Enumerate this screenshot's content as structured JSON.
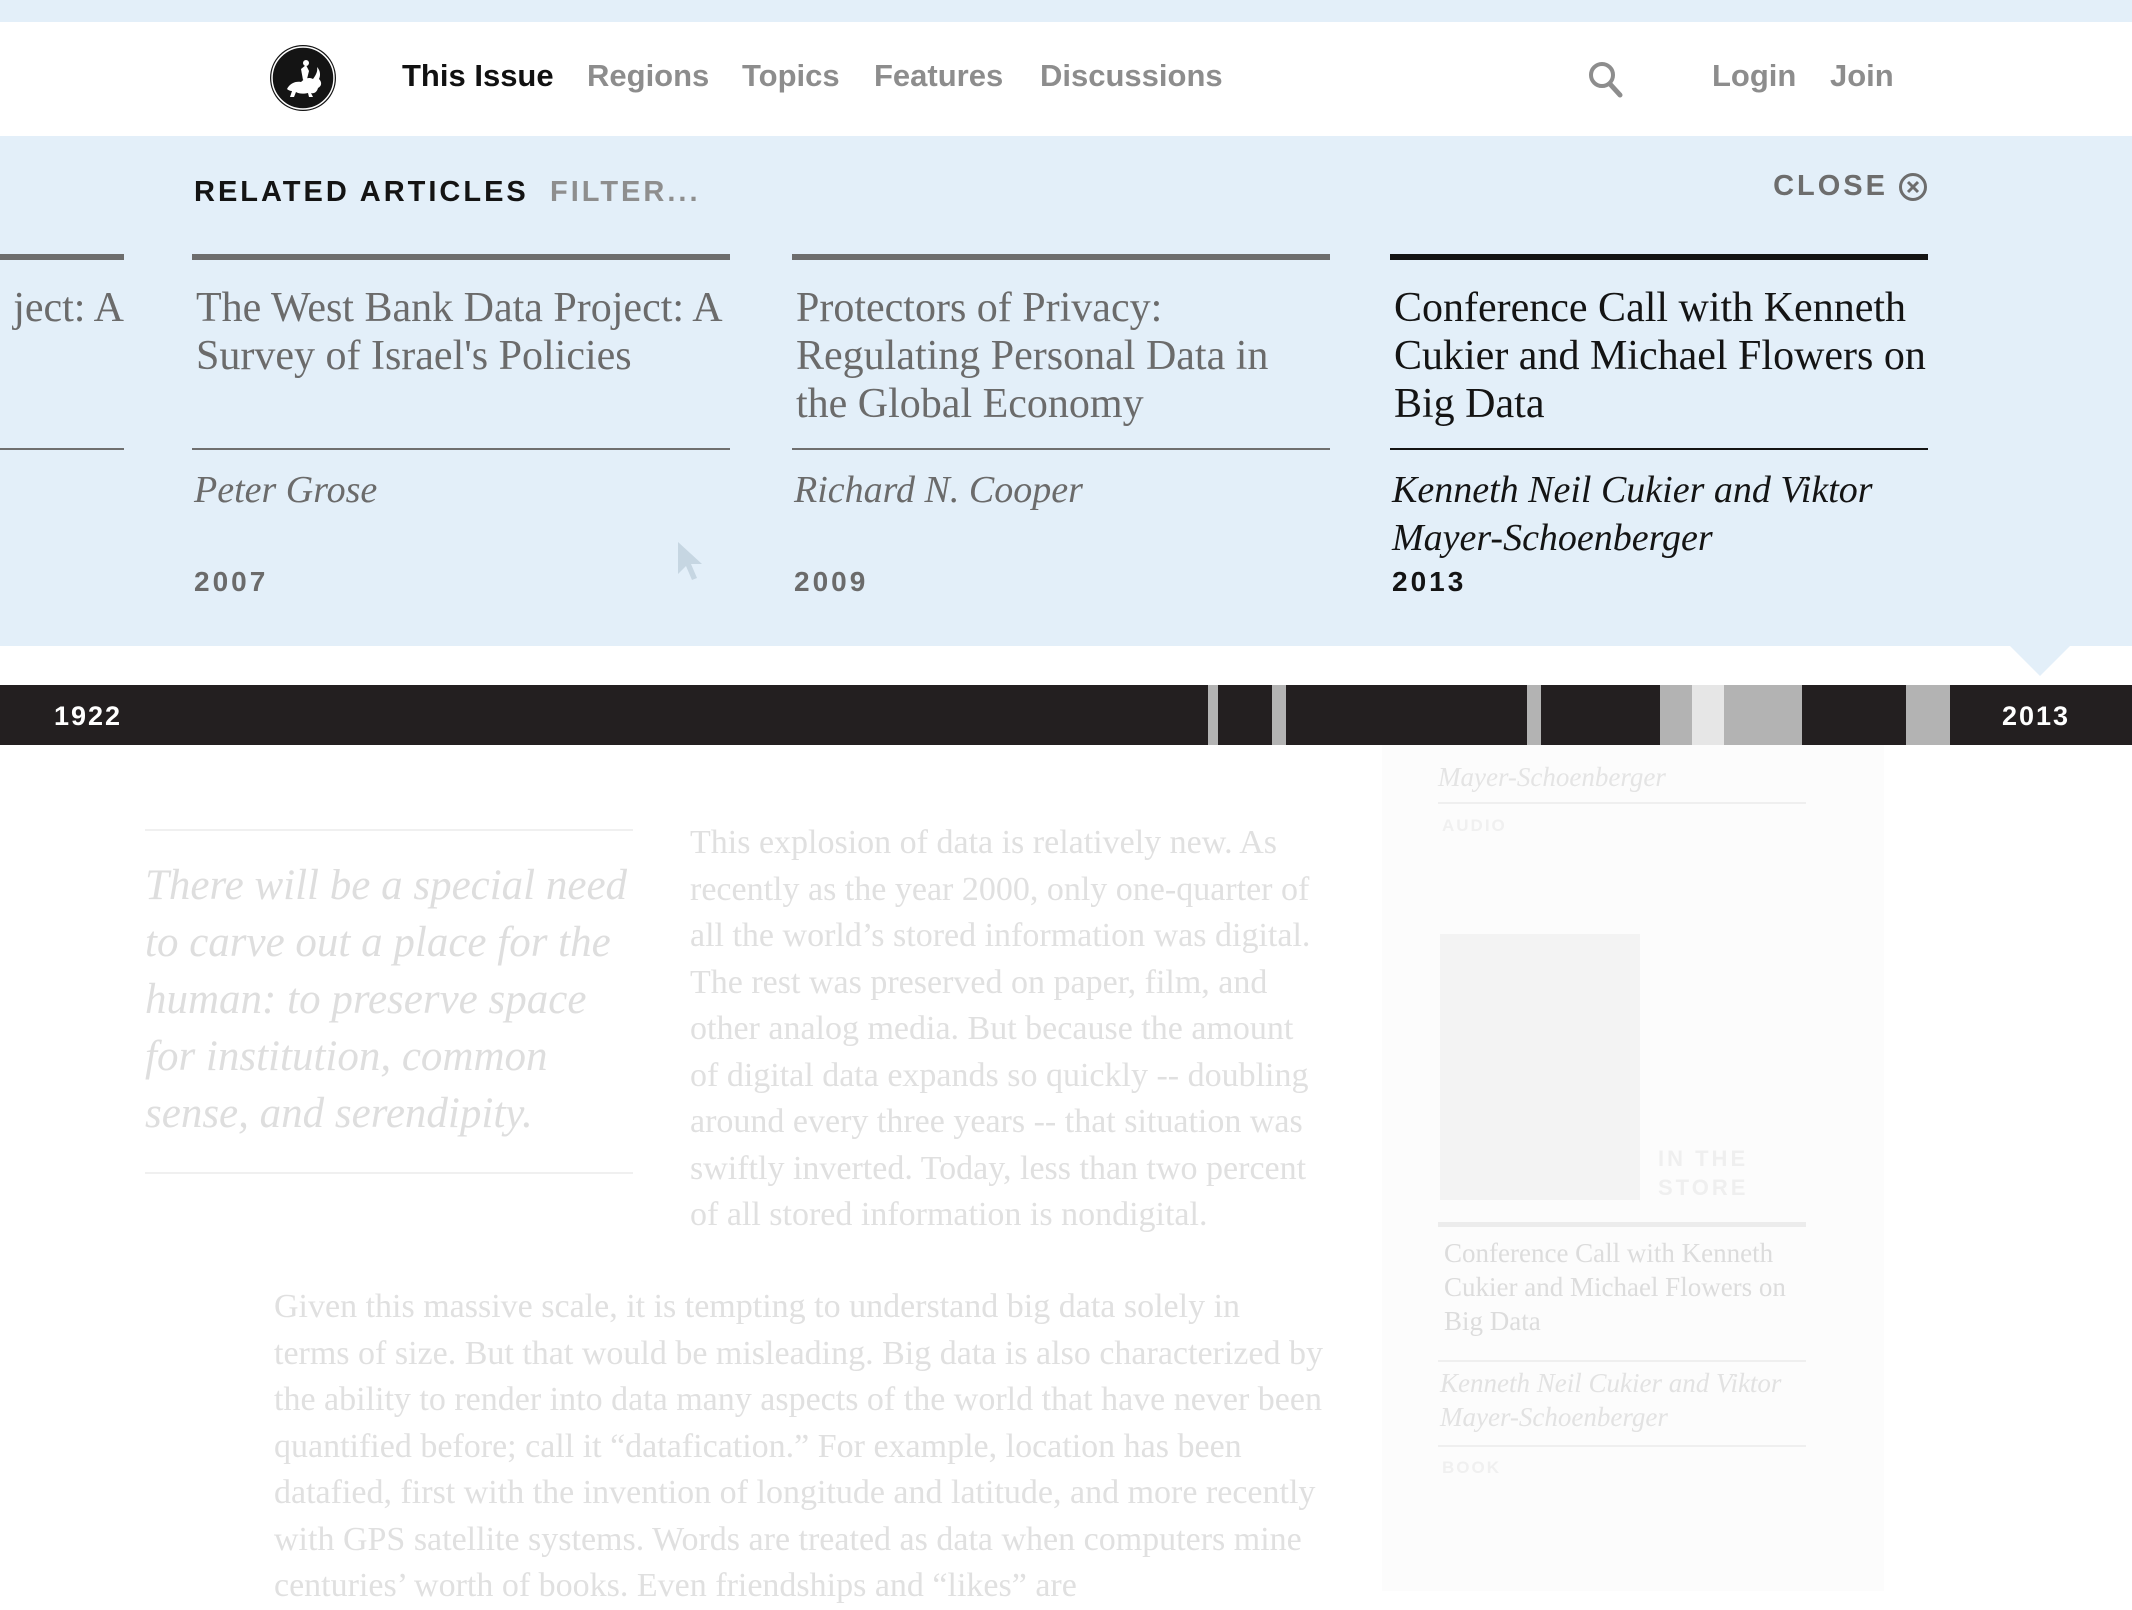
{
  "nav": {
    "logo_name": "horseman-logo",
    "links": [
      {
        "label": "This Issue",
        "active": true
      },
      {
        "label": "Regions",
        "active": false
      },
      {
        "label": "Topics",
        "active": false
      },
      {
        "label": "Features",
        "active": false
      },
      {
        "label": "Discussions",
        "active": false
      }
    ],
    "search_icon": "search-icon",
    "login_label": "Login",
    "join_label": "Join"
  },
  "related": {
    "heading": "RELATED ARTICLES",
    "filter_label": "FILTER...",
    "close_label": "CLOSE",
    "close_icon": "close-circle-icon",
    "cards": [
      {
        "title": "ject: A",
        "author": "",
        "year": "",
        "active": false,
        "partial": true
      },
      {
        "title": "The West Bank Data Project: A Survey of Israel's Policies",
        "author": "Peter Grose",
        "year": "2007",
        "active": false,
        "partial": false
      },
      {
        "title": "Protectors of Privacy: Regulating Personal Data in the Global Economy",
        "author": "Richard N. Cooper",
        "year": "2009",
        "active": false,
        "partial": false
      },
      {
        "title": "Conference Call with Kenneth Cukier and Michael Flowers on Big Data",
        "author": "Kenneth Neil Cukier and Viktor Mayer-Schoenberger",
        "year": "2013",
        "active": true,
        "partial": false
      }
    ]
  },
  "timeline": {
    "start_label": "1922",
    "end_label": "2013",
    "colors": {
      "dark": "#231f20",
      "mid": "#b3b3b3",
      "light": "#e6e6e6"
    }
  },
  "article": {
    "pullquote": "There will be a special need to carve out a place for the human: to preserve space for institution, common sense, and serendipity.",
    "paragraph_1": "This explosion of data is relatively new. As recently as the year 2000, only one-quarter of all the world’s stored information was digital. The rest was preserved on paper, film, and other analog media. But because the amount of digital data expands so quickly -- doubling around every three years -- that situation was swiftly inverted. Today, less than two percent of all stored information is nondigital.",
    "paragraph_2": "Given this massive scale, it is tempting to understand big data solely in terms of size. But that would be misleading. Big data is also characterized by the ability to render into data many aspects of the world that have never been quantified before; call it “datafication.” For example, location has been datafied, first with the invention of longitude and latitude, and more recently with GPS satellite systems. Words are treated as data when computers mine centuries’ worth of books. Even friendships and “likes” are",
    "sidebar": {
      "author_top": "Mayer-Schoenberger",
      "audio_label": "AUDIO",
      "store_label": "IN THE STORE",
      "title": "Conference Call with Kenneth Cukier and Michael Flowers on Big Data",
      "author": "Kenneth Neil Cukier and Viktor Mayer-Schoenberger",
      "book_label": "BOOK"
    }
  }
}
